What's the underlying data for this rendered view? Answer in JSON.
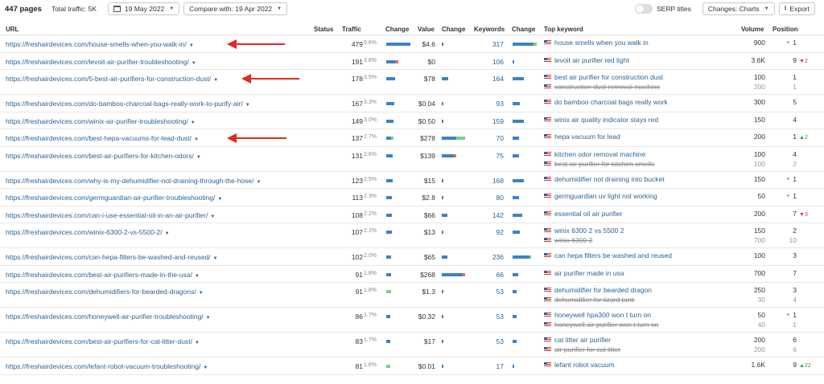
{
  "toolbar": {
    "pages": "447 pages",
    "total_traffic": "Total traffic: 5K",
    "date": "19 May 2022",
    "compare": "Compare with: 19 Apr 2022",
    "serp_titles": "SERP titles",
    "changes": "Changes: Charts",
    "export": "Export"
  },
  "headers": {
    "url": "URL",
    "status": "Status",
    "traffic": "Traffic",
    "change1": "Change",
    "value": "Value",
    "change2": "Change",
    "keywords": "Keywords",
    "change3": "Change",
    "top_keyword": "Top keyword",
    "volume": "Volume",
    "position": "Position"
  },
  "colors": {
    "link": "#2a6496",
    "bar_blue": "#3b82c8",
    "bar_green": "#7ccf8a",
    "bar_red": "#e46a7a",
    "arrow": "#e02a1f",
    "up": "#2e9e3e",
    "down": "#d23b3b"
  },
  "rows": [
    {
      "url": "https://freshairdevices.com/house-smells-when-you-walk-in/",
      "traffic": "479",
      "pct": "9.6%",
      "value": "$4.6",
      "keywords": "317",
      "top_keyword": [
        "house smells when you walk in"
      ],
      "volume": [
        "900"
      ],
      "position": [
        "1"
      ],
      "serp": true,
      "delta": null,
      "tbar": [
        {
          "c": "bar_blue",
          "v": 1.0
        }
      ],
      "vbar": [
        {
          "c": "bar_blue",
          "v": 0.02
        }
      ],
      "kbar": [
        {
          "c": "bar_blue",
          "v": 0.85
        },
        {
          "c": "bar_green",
          "v": 0.15
        }
      ],
      "arrow": true
    },
    {
      "url": "https://freshairdevices.com/levoit-air-purifier-troubleshooting/",
      "traffic": "191",
      "pct": "3.8%",
      "value": "$0",
      "keywords": "106",
      "top_keyword": [
        "levoit air purifier red light"
      ],
      "volume": [
        "3.6K"
      ],
      "position": [
        "9"
      ],
      "serp": false,
      "delta": {
        "dir": "down",
        "val": "2"
      },
      "tbar": [
        {
          "c": "bar_blue",
          "v": 0.35
        },
        {
          "c": "bar_red",
          "v": 0.15
        }
      ],
      "vbar": [],
      "kbar": [
        {
          "c": "bar_blue",
          "v": 0.02
        }
      ],
      "arrow": false
    },
    {
      "url": "https://freshairdevices.com/5-best-air-purifiers-for-construction-dust/",
      "traffic": "178",
      "pct": "3.5%",
      "value": "$78",
      "keywords": "164",
      "top_keyword": [
        "best air purifier for construction dust",
        "construction dust removal machine"
      ],
      "volume": [
        "100",
        "200"
      ],
      "position": [
        "1",
        "1"
      ],
      "serp": false,
      "delta": null,
      "tbar": [
        {
          "c": "bar_blue",
          "v": 0.35
        }
      ],
      "vbar": [
        {
          "c": "bar_blue",
          "v": 0.25
        }
      ],
      "kbar": [
        {
          "c": "bar_blue",
          "v": 0.45
        }
      ],
      "arrow": true
    },
    {
      "url": "https://freshairdevices.com/do-bamboo-charcoal-bags-really-work-to-purify-air/",
      "traffic": "167",
      "pct": "3.3%",
      "value": "$0.04",
      "keywords": "93",
      "top_keyword": [
        "do bamboo charcoal bags really work"
      ],
      "volume": [
        "300"
      ],
      "position": [
        "5"
      ],
      "serp": false,
      "delta": null,
      "tbar": [
        {
          "c": "bar_blue",
          "v": 0.33
        }
      ],
      "vbar": [
        {
          "c": "bar_blue",
          "v": 0.02
        }
      ],
      "kbar": [
        {
          "c": "bar_blue",
          "v": 0.3
        }
      ],
      "arrow": false
    },
    {
      "url": "https://freshairdevices.com/winix-air-purifier-troubleshooting/",
      "traffic": "149",
      "pct": "3.0%",
      "value": "$0.50",
      "keywords": "159",
      "top_keyword": [
        "winix air quality indicator stays red"
      ],
      "volume": [
        "150"
      ],
      "position": [
        "4"
      ],
      "serp": false,
      "delta": null,
      "tbar": [
        {
          "c": "bar_blue",
          "v": 0.3
        }
      ],
      "vbar": [
        {
          "c": "bar_blue",
          "v": 0.02
        }
      ],
      "kbar": [
        {
          "c": "bar_blue",
          "v": 0.45
        }
      ],
      "arrow": false
    },
    {
      "url": "https://freshairdevices.com/best-hepa-vacuums-for-lead-dust/",
      "traffic": "137",
      "pct": "2.7%",
      "value": "$278",
      "keywords": "70",
      "top_keyword": [
        "hepa vacuum for lead"
      ],
      "volume": [
        "200"
      ],
      "position": [
        "1"
      ],
      "serp": false,
      "delta": {
        "dir": "up",
        "val": "2"
      },
      "tbar": [
        {
          "c": "bar_blue",
          "v": 0.2
        },
        {
          "c": "bar_green",
          "v": 0.1
        }
      ],
      "vbar": [
        {
          "c": "bar_blue",
          "v": 0.6
        },
        {
          "c": "bar_green",
          "v": 0.35
        }
      ],
      "kbar": [
        {
          "c": "bar_blue",
          "v": 0.25
        }
      ],
      "arrow": true
    },
    {
      "url": "https://freshairdevices.com/best-air-purifiers-for-kitchen-odors/",
      "traffic": "131",
      "pct": "2.6%",
      "value": "$139",
      "keywords": "75",
      "top_keyword": [
        "kitchen odor removal machine",
        "best air purifier for kitchen smells"
      ],
      "volume": [
        "100",
        "100"
      ],
      "position": [
        "4",
        "2"
      ],
      "serp": false,
      "delta": null,
      "tbar": [
        {
          "c": "bar_blue",
          "v": 0.28
        }
      ],
      "vbar": [
        {
          "c": "bar_blue",
          "v": 0.5
        },
        {
          "c": "bar_red",
          "v": 0.1
        }
      ],
      "kbar": [
        {
          "c": "bar_blue",
          "v": 0.25
        }
      ],
      "arrow": false
    },
    {
      "url": "https://freshairdevices.com/why-is-my-dehumidifier-not-draining-through-the-hose/",
      "traffic": "123",
      "pct": "2.5%",
      "value": "$15",
      "keywords": "168",
      "top_keyword": [
        "dehumidifier not draining into bucket"
      ],
      "volume": [
        "150"
      ],
      "position": [
        "1"
      ],
      "serp": true,
      "delta": null,
      "tbar": [
        {
          "c": "bar_blue",
          "v": 0.25
        }
      ],
      "vbar": [
        {
          "c": "bar_blue",
          "v": 0.06
        }
      ],
      "kbar": [
        {
          "c": "bar_blue",
          "v": 0.45
        }
      ],
      "arrow": false
    },
    {
      "url": "https://freshairdevices.com/germguardian-air-purifier-troubleshooting/",
      "traffic": "113",
      "pct": "2.3%",
      "value": "$2.8",
      "keywords": "80",
      "top_keyword": [
        "germguardian uv light not working"
      ],
      "volume": [
        "50"
      ],
      "position": [
        "1"
      ],
      "serp": true,
      "delta": null,
      "tbar": [
        {
          "c": "bar_blue",
          "v": 0.23
        }
      ],
      "vbar": [
        {
          "c": "bar_blue",
          "v": 0.02
        }
      ],
      "kbar": [
        {
          "c": "bar_blue",
          "v": 0.25
        }
      ],
      "arrow": false
    },
    {
      "url": "https://freshairdevices.com/can-i-use-essential-oil-in-an-air-purifier/",
      "traffic": "108",
      "pct": "2.2%",
      "value": "$66",
      "keywords": "142",
      "top_keyword": [
        "essential oil air purifier"
      ],
      "volume": [
        "200"
      ],
      "position": [
        "7"
      ],
      "serp": false,
      "delta": {
        "dir": "down",
        "val": "3"
      },
      "tbar": [
        {
          "c": "bar_blue",
          "v": 0.22
        }
      ],
      "vbar": [
        {
          "c": "bar_blue",
          "v": 0.22
        }
      ],
      "kbar": [
        {
          "c": "bar_blue",
          "v": 0.4
        }
      ],
      "arrow": false
    },
    {
      "url": "https://freshairdevices.com/winix-6300-2-vs-5500-2/",
      "traffic": "107",
      "pct": "2.1%",
      "value": "$13",
      "keywords": "92",
      "top_keyword": [
        "winix 6300 2 vs 5500 2",
        "winix 6300 2"
      ],
      "volume": [
        "150",
        "700"
      ],
      "position": [
        "2",
        "10"
      ],
      "serp": false,
      "delta": null,
      "tbar": [
        {
          "c": "bar_blue",
          "v": 0.22
        }
      ],
      "vbar": [
        {
          "c": "bar_blue",
          "v": 0.05
        }
      ],
      "kbar": [
        {
          "c": "bar_blue",
          "v": 0.3
        }
      ],
      "arrow": false
    },
    {
      "url": "https://freshairdevices.com/can-hepa-filters-be-washed-and-reused/",
      "traffic": "102",
      "pct": "2.0%",
      "value": "$65",
      "keywords": "236",
      "top_keyword": [
        "can hepa filters be washed and reused"
      ],
      "volume": [
        "100"
      ],
      "position": [
        "3"
      ],
      "serp": false,
      "delta": null,
      "tbar": [
        {
          "c": "bar_blue",
          "v": 0.21
        }
      ],
      "vbar": [
        {
          "c": "bar_blue",
          "v": 0.22
        }
      ],
      "kbar": [
        {
          "c": "bar_blue",
          "v": 0.7
        },
        {
          "c": "bar_green",
          "v": 0.05
        }
      ],
      "arrow": false
    },
    {
      "url": "https://freshairdevices.com/best-air-purifiers-made-in-the-usa/",
      "traffic": "91",
      "pct": "1.8%",
      "value": "$268",
      "keywords": "66",
      "top_keyword": [
        "air purifier made in usa"
      ],
      "volume": [
        "700"
      ],
      "position": [
        "7"
      ],
      "serp": false,
      "delta": null,
      "tbar": [
        {
          "c": "bar_blue",
          "v": 0.19
        }
      ],
      "vbar": [
        {
          "c": "bar_blue",
          "v": 0.85
        },
        {
          "c": "bar_red",
          "v": 0.1
        }
      ],
      "kbar": [
        {
          "c": "bar_blue",
          "v": 0.22
        }
      ],
      "arrow": false
    },
    {
      "url": "https://freshairdevices.com/dehumidifiers-for-bearded-dragons/",
      "traffic": "91",
      "pct": "1.8%",
      "value": "$1.3",
      "keywords": "53",
      "top_keyword": [
        "dehumidifier for bearded dragon",
        "dehumidifier for lizard tank"
      ],
      "volume": [
        "250",
        "30"
      ],
      "position": [
        "3",
        "4"
      ],
      "serp": false,
      "delta": null,
      "tbar": [
        {
          "c": "bar_green",
          "v": 0.19
        }
      ],
      "vbar": [
        {
          "c": "bar_blue",
          "v": 0.02
        }
      ],
      "kbar": [
        {
          "c": "bar_blue",
          "v": 0.18
        }
      ],
      "arrow": false
    },
    {
      "url": "https://freshairdevices.com/honeywell-air-purifier-troubleshooting/",
      "traffic": "86",
      "pct": "1.7%",
      "value": "$0.32",
      "keywords": "53",
      "top_keyword": [
        "honeywell hpa300 won t turn on",
        "honeywell air purifier won t turn on"
      ],
      "volume": [
        "50",
        "40"
      ],
      "position": [
        "1",
        "1"
      ],
      "serp": true,
      "delta": null,
      "tbar": [
        {
          "c": "bar_blue",
          "v": 0.18
        }
      ],
      "vbar": [
        {
          "c": "bar_blue",
          "v": 0.02
        }
      ],
      "kbar": [
        {
          "c": "bar_blue",
          "v": 0.18
        }
      ],
      "arrow": false
    },
    {
      "url": "https://freshairdevices.com/best-air-purifiers-for-cat-litter-dust/",
      "traffic": "83",
      "pct": "1.7%",
      "value": "$17",
      "keywords": "53",
      "top_keyword": [
        "cat litter air purifier",
        "air purifier for cat litter"
      ],
      "volume": [
        "200",
        "200"
      ],
      "position": [
        "6",
        "6"
      ],
      "serp": false,
      "delta": null,
      "tbar": [
        {
          "c": "bar_blue",
          "v": 0.17
        }
      ],
      "vbar": [
        {
          "c": "bar_blue",
          "v": 0.08
        }
      ],
      "kbar": [
        {
          "c": "bar_blue",
          "v": 0.18
        }
      ],
      "arrow": false
    },
    {
      "url": "https://freshairdevices.com/lefant-robot-vacuum-troubleshooting/",
      "traffic": "81",
      "pct": "1.6%",
      "value": "$0.01",
      "keywords": "17",
      "top_keyword": [
        "lefant robot vacuum"
      ],
      "volume": [
        "1.6K"
      ],
      "position": [
        "9"
      ],
      "serp": false,
      "delta": {
        "dir": "up",
        "val": "22"
      },
      "tbar": [
        {
          "c": "bar_green",
          "v": 0.17
        }
      ],
      "vbar": [
        {
          "c": "bar_blue",
          "v": 0.02
        }
      ],
      "kbar": [
        {
          "c": "bar_blue",
          "v": 0.04
        }
      ],
      "arrow": false
    }
  ]
}
